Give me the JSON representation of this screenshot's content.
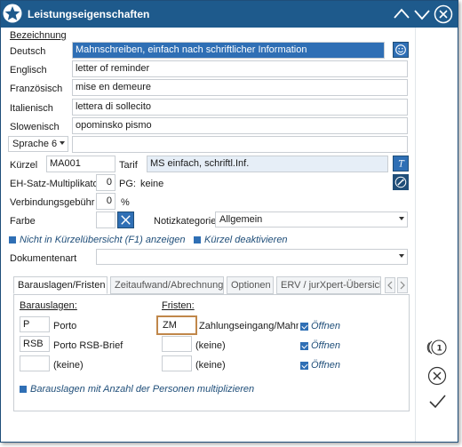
{
  "window": {
    "title": "Leistungseigenschaften"
  },
  "header": {
    "bezeichnung": "Bezeichnung"
  },
  "languages": [
    {
      "label": "Deutsch",
      "value": "Mahnschreiben, einfach nach schriftlicher Information"
    },
    {
      "label": "Englisch",
      "value": "letter of reminder"
    },
    {
      "label": "Französisch",
      "value": "mise en demeure"
    },
    {
      "label": "Italienisch",
      "value": "lettera di sollecito"
    },
    {
      "label": "Slowenisch",
      "value": "opominsko pismo"
    }
  ],
  "sprache6": {
    "label": "Sprache 6",
    "value": ""
  },
  "kuerzel": {
    "label": "Kürzel",
    "value": "MA001"
  },
  "tarif": {
    "label": "Tarif",
    "value": "MS einfach, schriftl.Inf."
  },
  "eh_satz": {
    "label": "EH-Satz-Multiplikator",
    "value": "0",
    "pg_label": "PG:",
    "pg_value": "keine"
  },
  "verbindung": {
    "label": "Verbindungsgebühr",
    "value": "0",
    "unit": "%"
  },
  "farbe": {
    "label": "Farbe"
  },
  "notizkategorie": {
    "label": "Notizkategorie",
    "value": "Allgemein"
  },
  "options": {
    "nicht_in_kuerzel": "Nicht in Kürzelübersicht (F1) anzeigen",
    "kuerzel_deaktiviert": "Kürzel deaktivieren"
  },
  "dokumentenart": {
    "label": "Dokumentenart",
    "value": ""
  },
  "tabs": [
    {
      "label": "Barauslagen/Fristen"
    },
    {
      "label": "Zeitaufwand/Abrechnung"
    },
    {
      "label": "Optionen"
    },
    {
      "label": "ERV / jurXpert-Übersicht"
    }
  ],
  "barauslagen": {
    "header": "Barauslagen:",
    "rows": [
      {
        "code": "P",
        "text": "Porto"
      },
      {
        "code": "RSB",
        "text": "Porto RSB-Brief"
      },
      {
        "code": "",
        "text": "(keine)"
      }
    ]
  },
  "fristen": {
    "header": "Fristen:",
    "rows": [
      {
        "code": "ZM",
        "text": "Zahlungseingang/Mahnkl",
        "open": "Öffnen"
      },
      {
        "code": "",
        "text": "(keine)",
        "open": "Öffnen"
      },
      {
        "code": "",
        "text": "(keine)",
        "open": "Öffnen"
      }
    ]
  },
  "multiply_option": "Barauslagen mit Anzahl der Personen multiplizieren",
  "colors": {
    "titlebar": "#1e5a8c",
    "accent": "#2f6fb5",
    "highlight_border": "#c0874a"
  },
  "icons": {
    "title": "star-icon",
    "minimize": "chevron-down-icon",
    "maximize": "chevron-up-icon",
    "close": "close-circle-icon",
    "smiley": "smiley-icon",
    "tarif_btn": "italic-t-icon",
    "edit": "edit-icon",
    "nav": "page-one-icon",
    "cancel": "cancel-circle-icon",
    "confirm": "checkmark-icon"
  }
}
